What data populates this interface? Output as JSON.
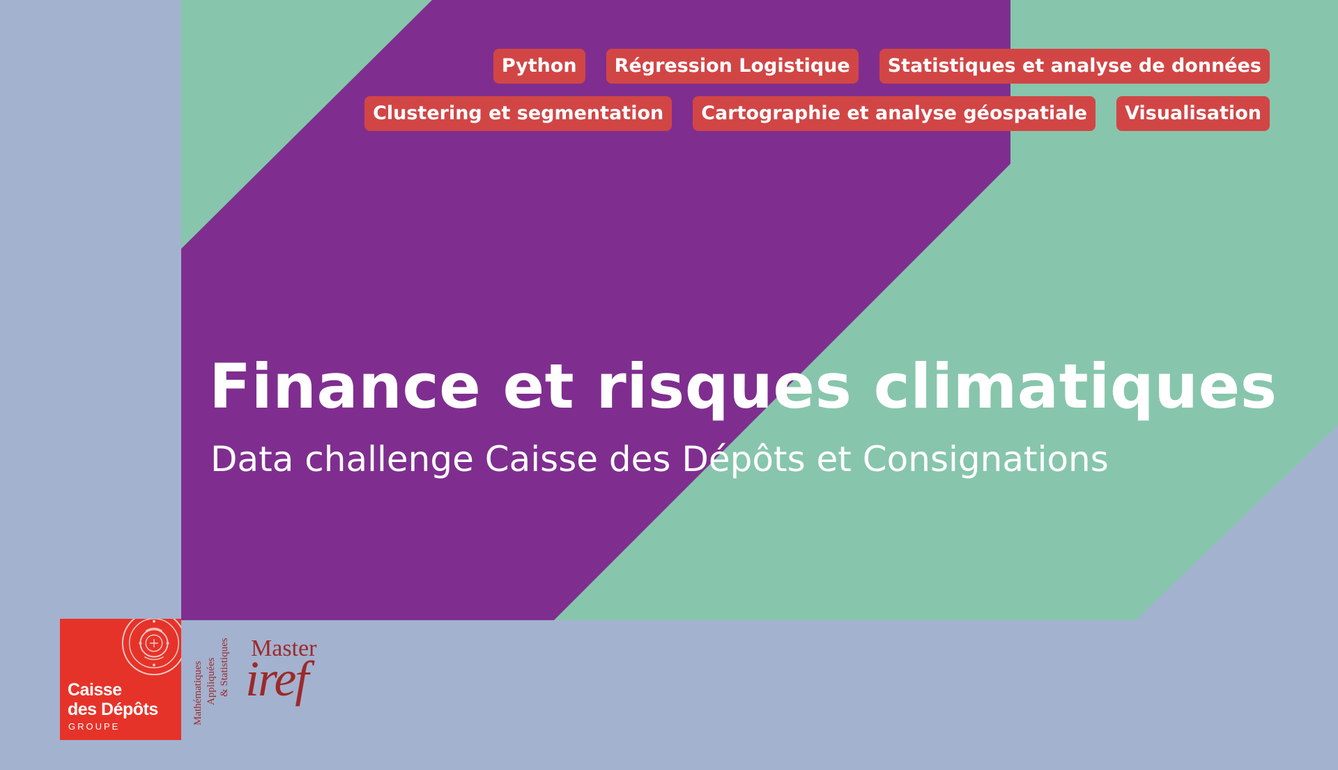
{
  "tags": {
    "row1": [
      "Python",
      "Régression Logistique",
      "Statistiques et analyse de données"
    ],
    "row2": [
      "Clustering et segmentation",
      "Cartographie et analyse géospatiale",
      "Visualisation"
    ]
  },
  "hero": {
    "title": "Finance et risques climatiques",
    "subtitle": "Data challenge Caisse des Dépôts et Consignations"
  },
  "logos": {
    "cdc": {
      "line1": "Caisse",
      "line2": "des Dépôts",
      "groupe": "GROUPE",
      "seal_icon": "seal-icon"
    },
    "mas": {
      "line1": "Mathématiques",
      "line2": "Appliquées",
      "line3": "& Statistiques"
    },
    "master": "Master",
    "iref": "iref"
  },
  "colors": {
    "background": "#a3b2cf",
    "purple": "#7f2e8f",
    "green": "#87c6ac",
    "tag": "#d24545",
    "cdc_red": "#e63329",
    "iref_red": "#9c2a2a"
  }
}
